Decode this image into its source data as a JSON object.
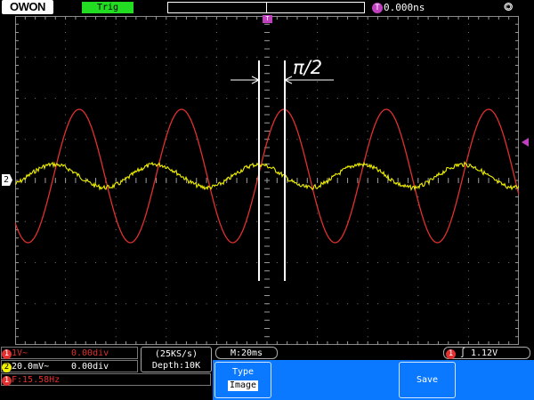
{
  "header": {
    "logo": "OWON",
    "trigger_status": "Trig",
    "trigger_offset": "0.000ns",
    "trigger_offset_icon": "T",
    "usb_icon": "usb-icon"
  },
  "screen": {
    "trigger_marker": "T",
    "channel2_marker": "2",
    "annotation": "π/2"
  },
  "channels": {
    "ch1": {
      "badge": "1",
      "scale": "1V~",
      "offset": "0.00div",
      "color": "#e03030"
    },
    "ch2": {
      "badge": "2",
      "scale": "20.0mV~",
      "offset": "0.00div",
      "color": "#f0f000"
    }
  },
  "measure": {
    "frequency": "F:15.58Hz"
  },
  "acquisition": {
    "sample_rate": "(25KS/s)",
    "depth": "Depth:10K"
  },
  "timebase": {
    "label": "M:20ms"
  },
  "trigger": {
    "source_badge": "1",
    "slope_symbol": "∫",
    "level": "1.12V"
  },
  "menu": {
    "type_label": "Type",
    "type_value": "Image",
    "save_label": "Save"
  },
  "colors": {
    "ch1": "#e03030",
    "ch2": "#f0f000",
    "trigger": "#c040c0",
    "menu": "#0a78ff",
    "trig_status": "#22dd22"
  }
}
